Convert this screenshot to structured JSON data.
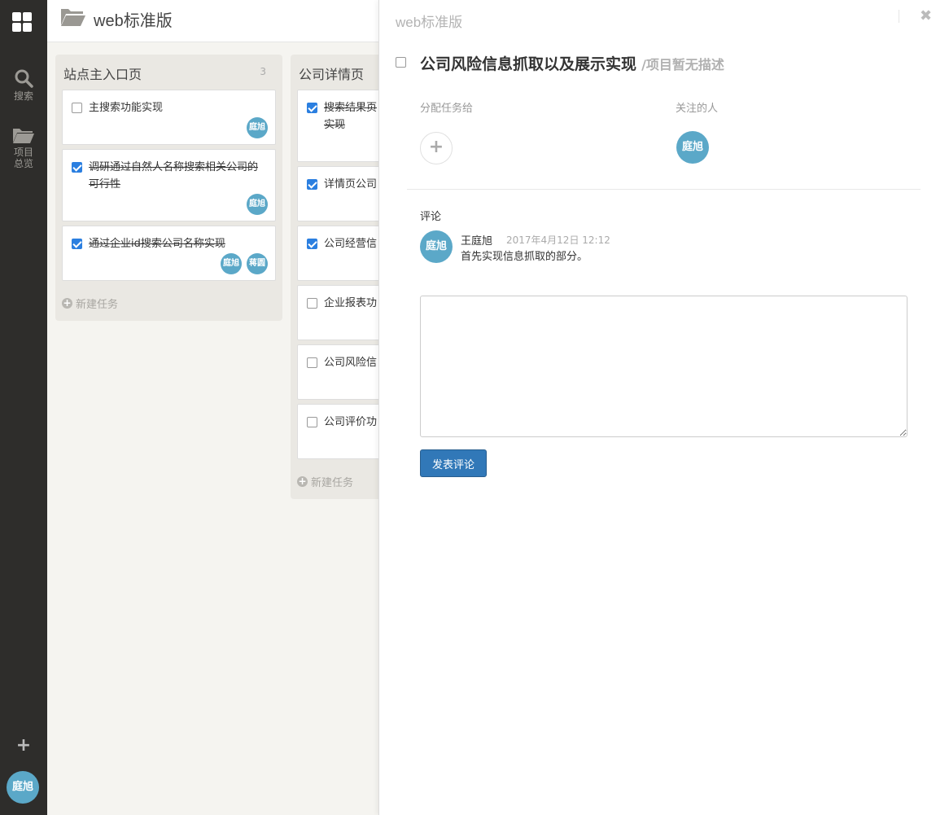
{
  "sidebar": {
    "logo_icon": "grid-icon",
    "search": {
      "icon": "search-icon",
      "label": "搜索"
    },
    "project": {
      "icon": "folder-icon",
      "label": "项目总览"
    },
    "add_icon": "+",
    "user_avatar": "庭旭"
  },
  "header": {
    "icon": "folder-open-icon",
    "title": "web标准版"
  },
  "columns": [
    {
      "title": "站点主入口页",
      "count": "3",
      "tasks": [
        {
          "text": "主搜索功能实现",
          "checked": false,
          "avatars": [
            "庭旭"
          ]
        },
        {
          "text": "调研通过自然人名称搜索相关公司的可行性",
          "checked": true,
          "avatars": [
            "庭旭"
          ]
        },
        {
          "text": "通过企业id搜索公司名称实现",
          "checked": true,
          "avatars": [
            "庭旭",
            "蒋圆"
          ]
        }
      ],
      "new_task": "新建任务"
    },
    {
      "title": "公司详情页",
      "tasks": [
        {
          "text": "搜索结果页实现",
          "checked": true
        },
        {
          "text": "详情页公司",
          "checked": true
        },
        {
          "text": "公司经营信",
          "checked": true
        },
        {
          "text": "企业报表功",
          "checked": false
        },
        {
          "text": "公司风险信",
          "checked": false
        },
        {
          "text": "公司评价功",
          "checked": false
        }
      ],
      "new_task": "新建任务"
    }
  ],
  "panel": {
    "project_name": "web标准版",
    "close_icon": "✖",
    "task_title": "公司风险信息抓取以及展示实现",
    "task_desc": "/项目暂无描述",
    "assign_label": "分配任务给",
    "watchers_label": "关注的人",
    "add_assign_icon": "+",
    "watcher_avatar": "庭旭",
    "comments_label": "评论",
    "comment": {
      "avatar": "庭旭",
      "author": "王庭旭",
      "time": "2017年4月12日 12:12",
      "text": "首先实现信息抓取的部分。"
    },
    "comment_input": {
      "value": "",
      "placeholder": ""
    },
    "submit_label": "发表评论"
  },
  "colors": {
    "sidebar_bg": "#2e2d2b",
    "avatar_bg": "#5ba8c8",
    "checkbox_checked": "#2b7fe0",
    "primary_button": "#3178b8"
  }
}
